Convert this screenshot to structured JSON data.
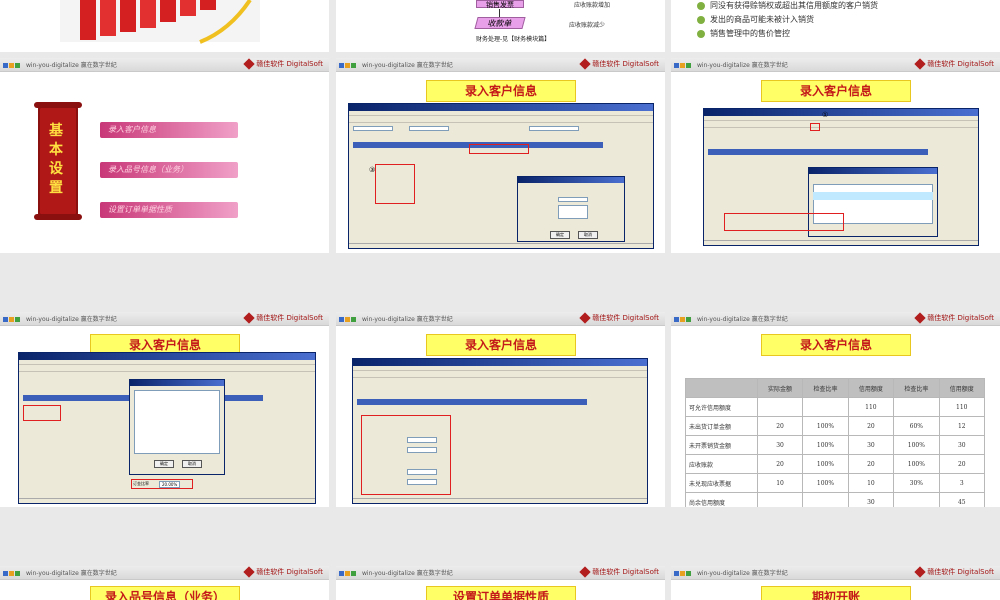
{
  "header": {
    "brand_text": "win-you-digitalize 赢在数字世纪",
    "logo_text": "赣佳软件 DigitalSoft"
  },
  "slide1": {
    "flow_box_1": "销售发票",
    "flow_box_2": "收款单",
    "flow_note_1": "应收账款增加",
    "flow_note_2": "应收账款减少",
    "flow_footer": "财务处理-见【财务模块篇】"
  },
  "slide2": {
    "bullets": [
      "同没有获得赊销权或超出其信用额度的客户销货",
      "发出的商品可能未被计入销货",
      "销售管理中的售价管控"
    ]
  },
  "slide3": {
    "scroll_title": "基本设置",
    "menu_items": [
      "录入客户信息",
      "录入品号信息（业务）",
      "设置订单单据性质"
    ]
  },
  "slide4": {
    "title": "录入客户信息",
    "marker_3": "③",
    "marker_4": "④",
    "confirm_label": "确定",
    "cancel_label": "取消"
  },
  "slide5": {
    "title": "录入客户信息",
    "marker": "①"
  },
  "slide6": {
    "title": "录入客户信息",
    "confirm_label": "确定",
    "cancel_label": "取消",
    "credit_ratio_label": "订金比率",
    "credit_ratio_value": "20.00%"
  },
  "slide7": {
    "title": "录入客户信息"
  },
  "slide8": {
    "title": "录入客户信息",
    "table": {
      "headers": [
        "",
        "实际金额",
        "检查比率",
        "信用额度",
        "检查比率",
        "信用额度"
      ],
      "rows": [
        [
          "可允许信用额度",
          "",
          "",
          "110",
          "",
          "110"
        ],
        [
          "未出货订单金额",
          "20",
          "100%",
          "20",
          "60%",
          "12"
        ],
        [
          "未开票销货金额",
          "30",
          "100%",
          "30",
          "100%",
          "30"
        ],
        [
          "应收账款",
          "20",
          "100%",
          "20",
          "100%",
          "20"
        ],
        [
          "未兑现应收票据",
          "10",
          "100%",
          "10",
          "30%",
          "3"
        ],
        [
          "尚余信用额度",
          "",
          "",
          "30",
          "",
          "45"
        ]
      ]
    }
  },
  "bottom": {
    "title_1": "录入品号信息（业务）",
    "title_2": "设置订单单据性质",
    "title_3": "期初开账"
  }
}
